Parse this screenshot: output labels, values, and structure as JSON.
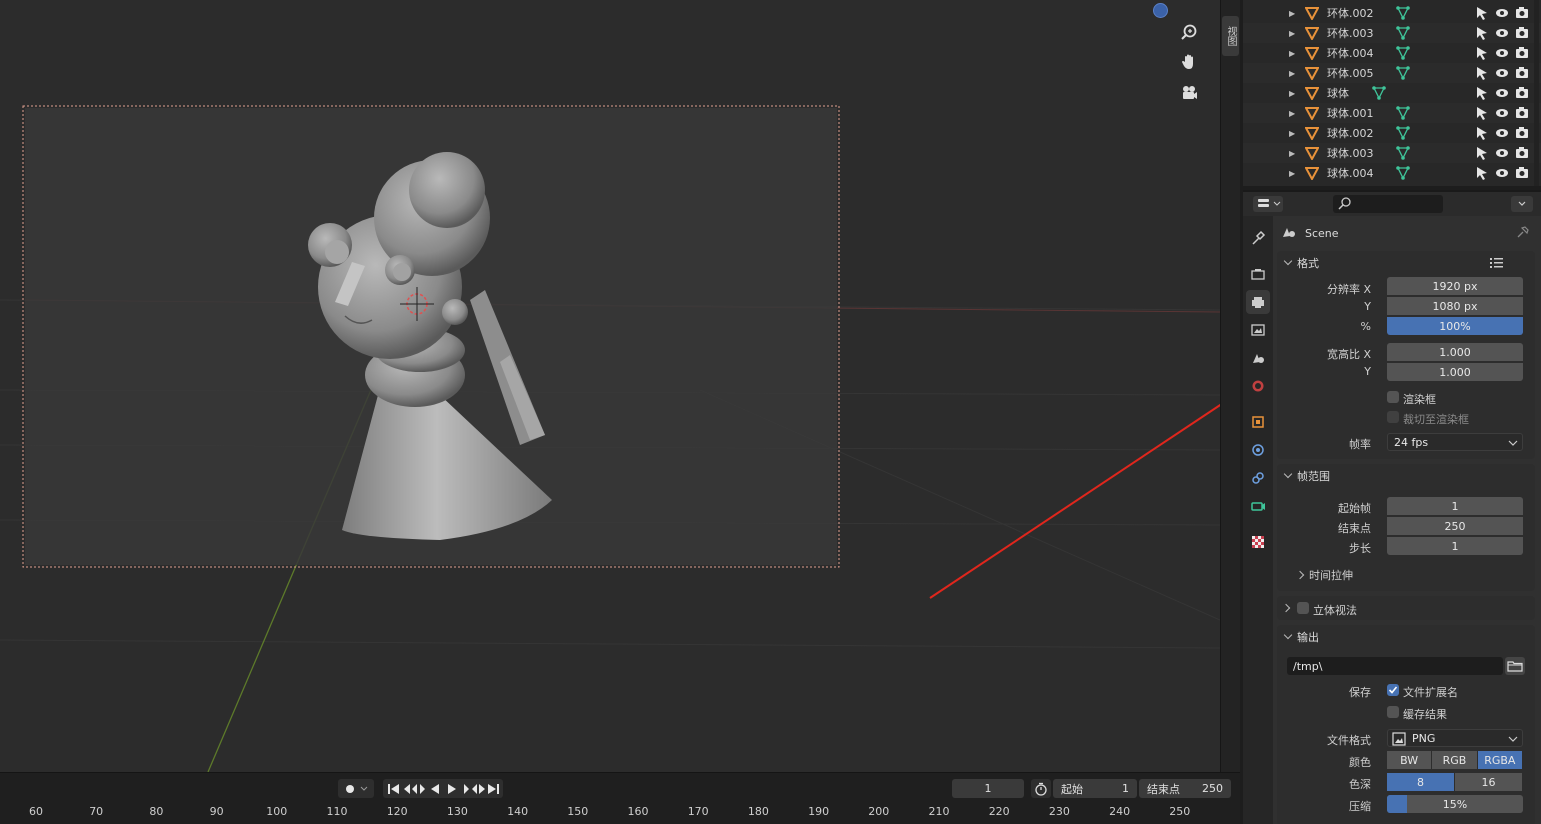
{
  "viewport": {
    "side_tab": "视图"
  },
  "outliner": {
    "items": [
      {
        "name": "环体.002"
      },
      {
        "name": "环体.003"
      },
      {
        "name": "环体.004"
      },
      {
        "name": "环体.005"
      },
      {
        "name": "球体"
      },
      {
        "name": "球体.001"
      },
      {
        "name": "球体.002"
      },
      {
        "name": "球体.003"
      },
      {
        "name": "球体.004"
      }
    ]
  },
  "properties": {
    "scene_label": "Scene",
    "format": {
      "title": "格式",
      "res_x_label": "分辨率 X",
      "res_x": "1920 px",
      "res_y_label": "Y",
      "res_y": "1080 px",
      "res_pct_label": "%",
      "res_pct": "100%",
      "aspect_x_label": "宽高比 X",
      "aspect_x": "1.000",
      "aspect_y_label": "Y",
      "aspect_y": "1.000",
      "render_region": "渲染框",
      "crop_to_region": "裁切至渲染框",
      "framerate_label": "帧率",
      "framerate": "24 fps"
    },
    "frame_range": {
      "title": "帧范围",
      "start_label": "起始帧",
      "start": "1",
      "end_label": "结束点",
      "end": "250",
      "step_label": "步长",
      "step": "1",
      "time_stretch": "时间拉伸"
    },
    "stereoscopy": {
      "title": "立体视法"
    },
    "output": {
      "title": "输出",
      "path": "/tmp\\",
      "save_label": "保存",
      "file_ext": "文件扩展名",
      "cache_result": "缓存结果",
      "file_format_label": "文件格式",
      "file_format": "PNG",
      "color_label": "颜色",
      "color_options": [
        "BW",
        "RGB",
        "RGBA"
      ],
      "color_selected": "RGBA",
      "depth_label": "色深",
      "depth_options": [
        "8",
        "16"
      ],
      "depth_selected": "8",
      "compression_label": "压缩",
      "compression": "15%",
      "compression_fraction": 0.15
    }
  },
  "timeline": {
    "current_frame": "1",
    "start_label": "起始",
    "start": "1",
    "end_label": "结束点",
    "end": "250",
    "ruler": [
      "60",
      "70",
      "80",
      "90",
      "100",
      "110",
      "120",
      "130",
      "140",
      "150",
      "160",
      "170",
      "180",
      "190",
      "200",
      "210",
      "220",
      "230",
      "240",
      "250"
    ]
  },
  "colors": {
    "accent": "#4772b3",
    "annotation_arrow": "#e0261c",
    "mesh_icon": "#e8923a",
    "data_icon": "#3fc59a"
  }
}
